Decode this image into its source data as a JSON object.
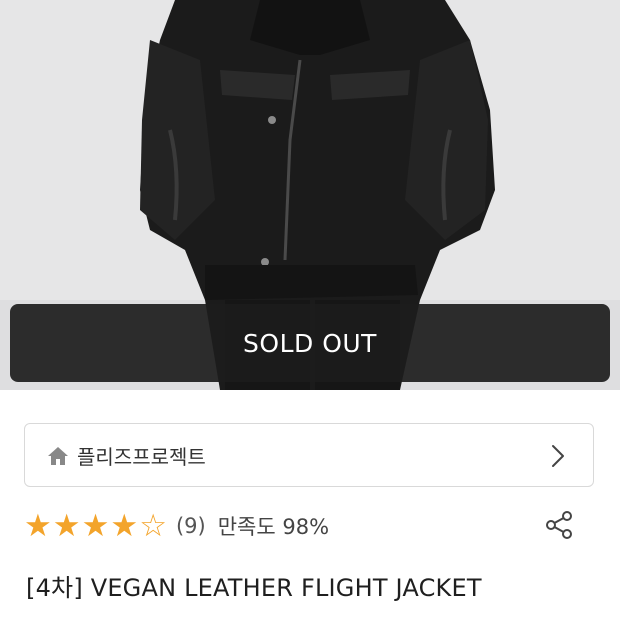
{
  "product": {
    "image_alt": "Black vegan leather flight jacket worn by model",
    "sold_out_label": "SOLD OUT",
    "brand": {
      "name": "플리즈프로젝트",
      "icon": "home-icon",
      "arrow_icon": "chevron-right-icon"
    },
    "rating": {
      "stars_filled": 4,
      "stars_total": 5,
      "review_count": "(9)",
      "satisfaction": "만족도 98%",
      "star_color": "#f3a42b"
    },
    "share_icon": "share-icon",
    "title": "[4차] VEGAN LEATHER FLIGHT JACKET"
  }
}
